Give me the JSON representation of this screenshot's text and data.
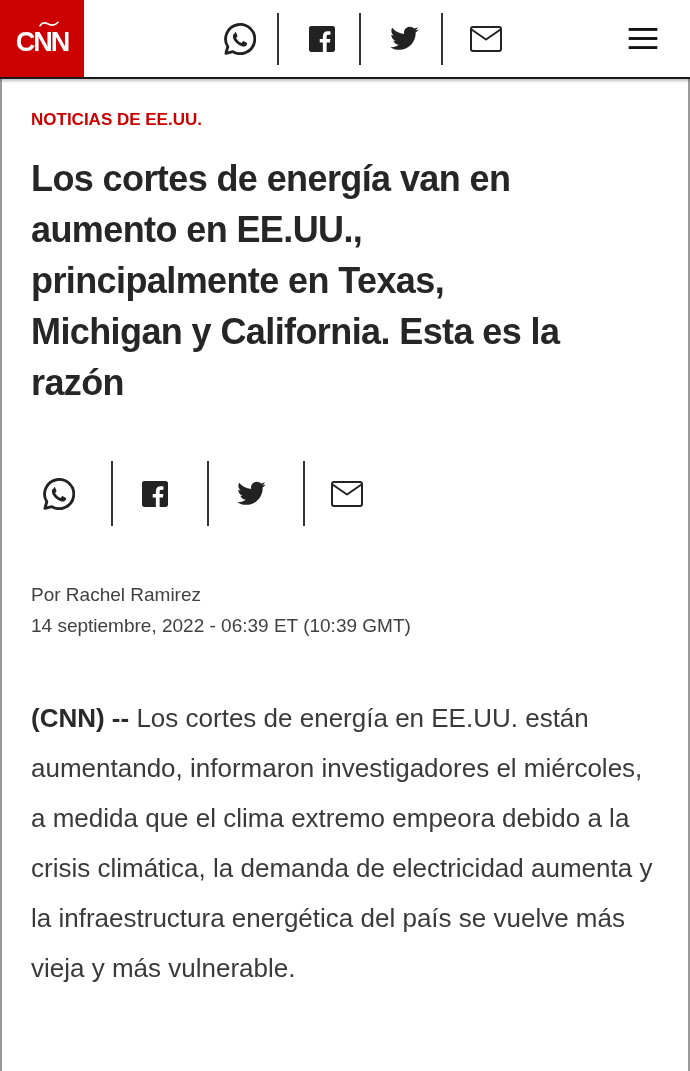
{
  "header": {
    "logo": "CNN",
    "share": [
      {
        "kind": "whatsapp"
      },
      {
        "kind": "facebook"
      },
      {
        "kind": "twitter"
      },
      {
        "kind": "email"
      }
    ]
  },
  "article": {
    "section": "NOTICIAS DE EE.UU.",
    "headline": "Los cortes de energía van en aumento en EE.UU., principalmente en Texas, Michigan y California. Esta es la razón",
    "share": [
      {
        "kind": "whatsapp"
      },
      {
        "kind": "facebook"
      },
      {
        "kind": "twitter"
      },
      {
        "kind": "email"
      }
    ],
    "byline": "Por Rachel Ramirez",
    "date": "14 septiembre, 2022 - 06:39 ET (10:39 GMT)",
    "body": "**(CNN) --** Los cortes de energía en EE.UU. están aumentando, informaron investigadores el miércoles, a medida que el clima extremo empeora debido a la crisis climática, la demanda de electricidad aumenta y la infraestructura energética del país se vuelve más vieja y más vulnerable."
  }
}
